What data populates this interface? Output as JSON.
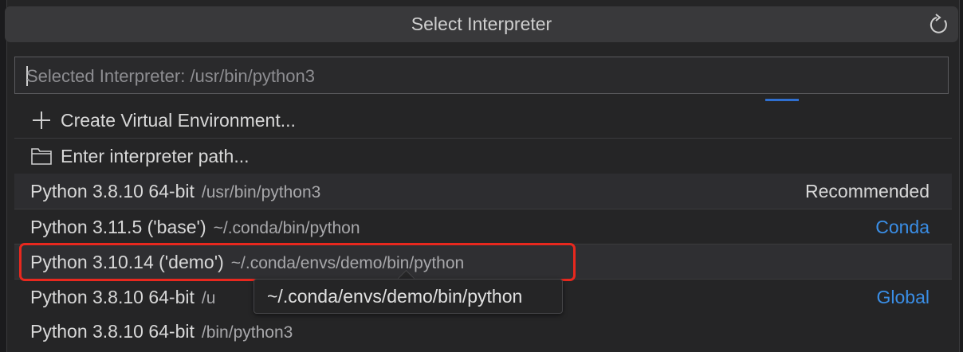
{
  "dialog": {
    "title": "Select Interpreter",
    "refresh_icon": "refresh-icon"
  },
  "search": {
    "placeholder": "Selected Interpreter: /usr/bin/python3",
    "value": ""
  },
  "actions": [
    {
      "icon": "plus-icon",
      "label": "Create Virtual Environment..."
    },
    {
      "icon": "folder-icon",
      "label": "Enter interpreter path..."
    }
  ],
  "interpreters": [
    {
      "name": "Python 3.8.10 64-bit",
      "path": "/usr/bin/python3",
      "tag": "Recommended",
      "tag_color": "#d8d8d8"
    },
    {
      "name": "Python 3.11.5 ('base')",
      "path": "~/.conda/bin/python",
      "tag": "Conda",
      "tag_color": "#3a8ee6"
    },
    {
      "name": "Python 3.10.14 ('demo')",
      "path": "~/.conda/envs/demo/bin/python",
      "tag": "",
      "tag_color": ""
    },
    {
      "name": "Python 3.8.10 64-bit",
      "path": "/u",
      "tag": "Global",
      "tag_color": "#3a8ee6"
    },
    {
      "name": "Python 3.8.10 64-bit",
      "path": "/bin/python3",
      "tag": "",
      "tag_color": ""
    }
  ],
  "tooltip": {
    "text": "~/.conda/envs/demo/bin/python"
  },
  "colors": {
    "accent": "#3a8ee6",
    "highlight_border": "#e8281e"
  }
}
